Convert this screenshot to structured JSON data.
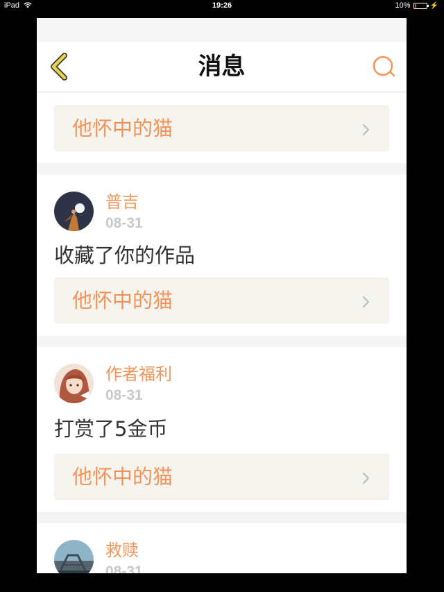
{
  "status_bar": {
    "device": "iPad",
    "time": "19:26",
    "battery": "10%",
    "battery_level": 0.1
  },
  "nav": {
    "title": "消息",
    "back_icon": "chevron-left-icon",
    "search_icon": "search-icon"
  },
  "colors": {
    "accent": "#f2945a",
    "chevron_back": "#e8d34a"
  },
  "messages": [
    {
      "work_title": "他怀中的猫"
    },
    {
      "user": "普吉",
      "date": "08-31",
      "action": "收藏了你的作品",
      "work_title": "他怀中的猫"
    },
    {
      "user": "作者福利",
      "date": "08-31",
      "action": "打赏了5金币",
      "work_title": "他怀中的猫"
    },
    {
      "user": "救赎",
      "date": "08-31"
    }
  ]
}
